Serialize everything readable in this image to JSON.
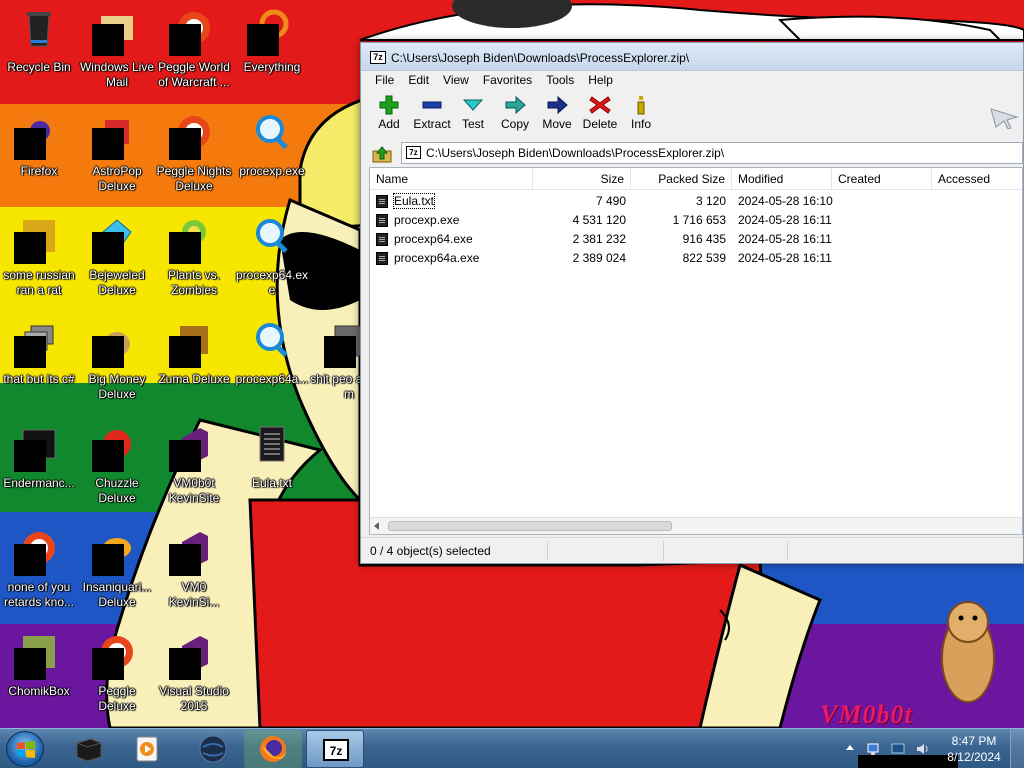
{
  "desktop": {
    "icons": [
      {
        "label": "Recycle Bin",
        "icon": "recycle-bin-icon"
      },
      {
        "label": "Windows Live Mail",
        "icon": "mail-icon"
      },
      {
        "label": "Peggle World of Warcraft ...",
        "icon": "peggle-icon"
      },
      {
        "label": "Everything",
        "icon": "search-ring-icon"
      },
      {
        "label": "Firefox",
        "icon": "firefox-icon"
      },
      {
        "label": "AstroPop Deluxe",
        "icon": "astropop-icon"
      },
      {
        "label": "Peggle Nights Deluxe",
        "icon": "peggle-nights-icon"
      },
      {
        "label": "procexp.exe",
        "icon": "magnifier-icon"
      },
      {
        "label": "some russian ran a rat",
        "icon": "ie-icon"
      },
      {
        "label": "Bejeweled Deluxe",
        "icon": "gem-icon"
      },
      {
        "label": "Plants vs. Zombies",
        "icon": "plant-icon"
      },
      {
        "label": "procexp64.exe",
        "icon": "magnifier-icon"
      },
      {
        "label": "that but its c#",
        "icon": "window-stack-icon"
      },
      {
        "label": "Big Money Deluxe",
        "icon": "money-bag-icon"
      },
      {
        "label": "Zuma Deluxe",
        "icon": "zuma-icon"
      },
      {
        "label": "procexp64a...",
        "icon": "magnifier-icon"
      },
      {
        "label": "shit peo asked m",
        "icon": "folder-icon"
      },
      {
        "label": "Endermanc...",
        "icon": "terminal-icon"
      },
      {
        "label": "Chuzzle Deluxe",
        "icon": "chuzzle-icon"
      },
      {
        "label": "VM0b0t KevinSite",
        "icon": "vs-icon"
      },
      {
        "label": "Eula.txt",
        "icon": "text-file-icon"
      },
      {
        "label": "none of you retards kno...",
        "icon": "opera-icon"
      },
      {
        "label": "Insaniquari... Deluxe",
        "icon": "fish-icon"
      },
      {
        "label": "VM0 KevinSi...",
        "icon": "vs-icon"
      },
      {
        "label": "ChomikBox",
        "icon": "hamster-box-icon"
      },
      {
        "label": "Peggle Deluxe",
        "icon": "peggle-icon"
      },
      {
        "label": "Visual Studio 2015",
        "icon": "vs-icon"
      }
    ],
    "watermark": "VM0b0t"
  },
  "window": {
    "title": "C:\\Users\\Joseph Biden\\Downloads\\ProcessExplorer.zip\\",
    "app_icon_text": "7z",
    "menu": [
      "File",
      "Edit",
      "View",
      "Favorites",
      "Tools",
      "Help"
    ],
    "toolbar": [
      {
        "label": "Add",
        "icon": "plus-icon"
      },
      {
        "label": "Extract",
        "icon": "minus-icon"
      },
      {
        "label": "Test",
        "icon": "check-arrow-icon"
      },
      {
        "label": "Copy",
        "icon": "arrow-right-icon"
      },
      {
        "label": "Move",
        "icon": "arrow-right-icon"
      },
      {
        "label": "Delete",
        "icon": "x-icon"
      },
      {
        "label": "Info",
        "icon": "info-icon"
      }
    ],
    "address": "C:\\Users\\Joseph Biden\\Downloads\\ProcessExplorer.zip\\",
    "columns": [
      "Name",
      "Size",
      "Packed Size",
      "Modified",
      "Created",
      "Accessed"
    ],
    "files": [
      {
        "name": "Eula.txt",
        "size": "7 490",
        "packed": "3 120",
        "modified": "2024-05-28 16:10",
        "created": "",
        "accessed": ""
      },
      {
        "name": "procexp.exe",
        "size": "4 531 120",
        "packed": "1 716 653",
        "modified": "2024-05-28 16:11",
        "created": "",
        "accessed": ""
      },
      {
        "name": "procexp64.exe",
        "size": "2 381 232",
        "packed": "916 435",
        "modified": "2024-05-28 16:11",
        "created": "",
        "accessed": ""
      },
      {
        "name": "procexp64a.exe",
        "size": "2 389 024",
        "packed": "822 539",
        "modified": "2024-05-28 16:11",
        "created": "",
        "accessed": ""
      }
    ],
    "status": "0 / 4 object(s) selected"
  },
  "taskbar": {
    "items": [
      {
        "name": "black-box-app",
        "icon": "black-box-icon"
      },
      {
        "name": "media-player",
        "icon": "media-player-icon"
      },
      {
        "name": "globe-app",
        "icon": "globe-icon"
      },
      {
        "name": "firefox",
        "icon": "firefox-icon"
      },
      {
        "name": "7-zip",
        "icon": "7zip-icon"
      }
    ],
    "active": "7-zip",
    "clock": {
      "time": "8:47 PM",
      "date": "8/12/2024"
    }
  }
}
